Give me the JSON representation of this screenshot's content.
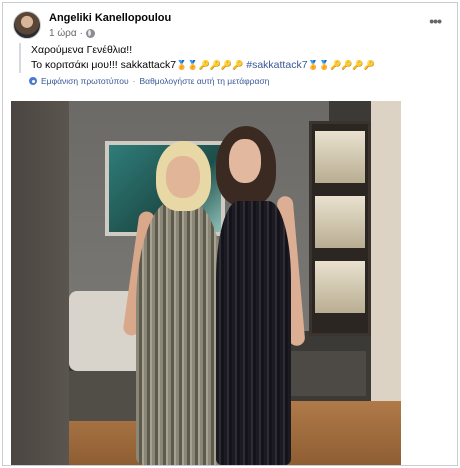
{
  "post": {
    "author": "Angeliki Kanellopoulou",
    "time": "1 ώρα",
    "more_icon": "more-horizontal-icon",
    "privacy_icon": "globe-icon",
    "line1": "Χαρούμενα Γενέθλια!!",
    "line2_text": "Το κοριτσάκι μου!!! sakkattack7",
    "line2_emojis_a": "🏅🏅🔑🔑🔑🔑",
    "hashtag": "#sakkattack7",
    "line2_emojis_b": "🏅🏅🔑🔑🔑🔑"
  },
  "translation": {
    "icon": "gear-icon",
    "show_original": "Εμφάνιση πρωτοτύπου",
    "separator": "·",
    "rate": "Βαθμολογήστε αυτή τη μετάφραση"
  },
  "photo": {
    "alt_icon": "photo-two-women"
  }
}
